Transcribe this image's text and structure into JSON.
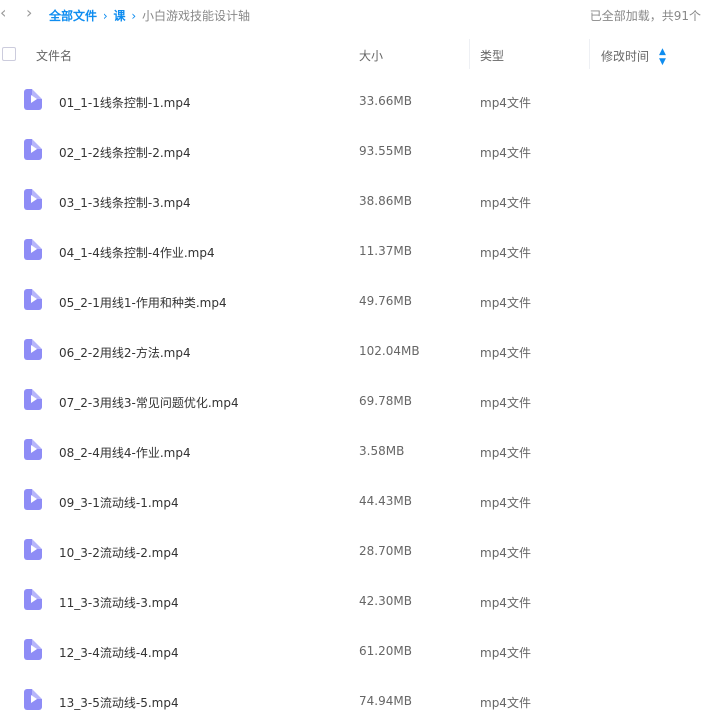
{
  "nav": {
    "back_glyph": "‹",
    "forward_glyph": "›"
  },
  "breadcrumb": {
    "root": "全部文件",
    "sep1": "›",
    "folder": "课",
    "sep2": "›",
    "current": "小白游戏技能设计轴"
  },
  "status": "已全部加载，共91个",
  "columns": {
    "name": "文件名",
    "size": "大小",
    "type": "类型",
    "modified": "修改时间"
  },
  "accent_color": "#0f8df0",
  "file_icon_color": "#8e8cf6",
  "files": [
    {
      "name": "01_1-1线条控制-1.mp4",
      "size": "33.66MB",
      "type": "mp4文件"
    },
    {
      "name": "02_1-2线条控制-2.mp4",
      "size": "93.55MB",
      "type": "mp4文件"
    },
    {
      "name": "03_1-3线条控制-3.mp4",
      "size": "38.86MB",
      "type": "mp4文件"
    },
    {
      "name": "04_1-4线条控制-4作业.mp4",
      "size": "11.37MB",
      "type": "mp4文件"
    },
    {
      "name": "05_2-1用线1-作用和种类.mp4",
      "size": "49.76MB",
      "type": "mp4文件"
    },
    {
      "name": "06_2-2用线2-方法.mp4",
      "size": "102.04MB",
      "type": "mp4文件"
    },
    {
      "name": "07_2-3用线3-常见问题优化.mp4",
      "size": "69.78MB",
      "type": "mp4文件"
    },
    {
      "name": "08_2-4用线4-作业.mp4",
      "size": "3.58MB",
      "type": "mp4文件"
    },
    {
      "name": "09_3-1流动线-1.mp4",
      "size": "44.43MB",
      "type": "mp4文件"
    },
    {
      "name": "10_3-2流动线-2.mp4",
      "size": "28.70MB",
      "type": "mp4文件"
    },
    {
      "name": "11_3-3流动线-3.mp4",
      "size": "42.30MB",
      "type": "mp4文件"
    },
    {
      "name": "12_3-4流动线-4.mp4",
      "size": "61.20MB",
      "type": "mp4文件"
    },
    {
      "name": "13_3-5流动线-5.mp4",
      "size": "74.94MB",
      "type": "mp4文件"
    }
  ]
}
